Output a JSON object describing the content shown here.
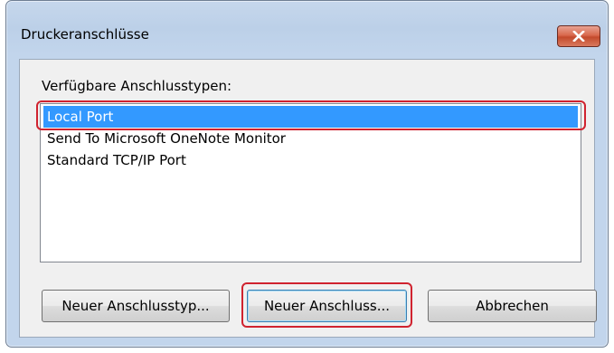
{
  "window": {
    "title": "Druckeranschlüsse",
    "close_icon": "close-x-icon"
  },
  "available_types": {
    "label": "Verfügbare Anschlusstypen:",
    "items": [
      "Local Port",
      "Send To Microsoft OneNote Monitor",
      "Standard TCP/IP Port"
    ],
    "selected": "Local Port"
  },
  "buttons": {
    "new_port_type": "Neuer Anschlusstyp...",
    "new_port": "Neuer Anschluss...",
    "cancel": "Abbrechen"
  },
  "colors": {
    "selection": "#3399ff",
    "highlight": "#d0232f",
    "close_button": "#c34a2c"
  }
}
